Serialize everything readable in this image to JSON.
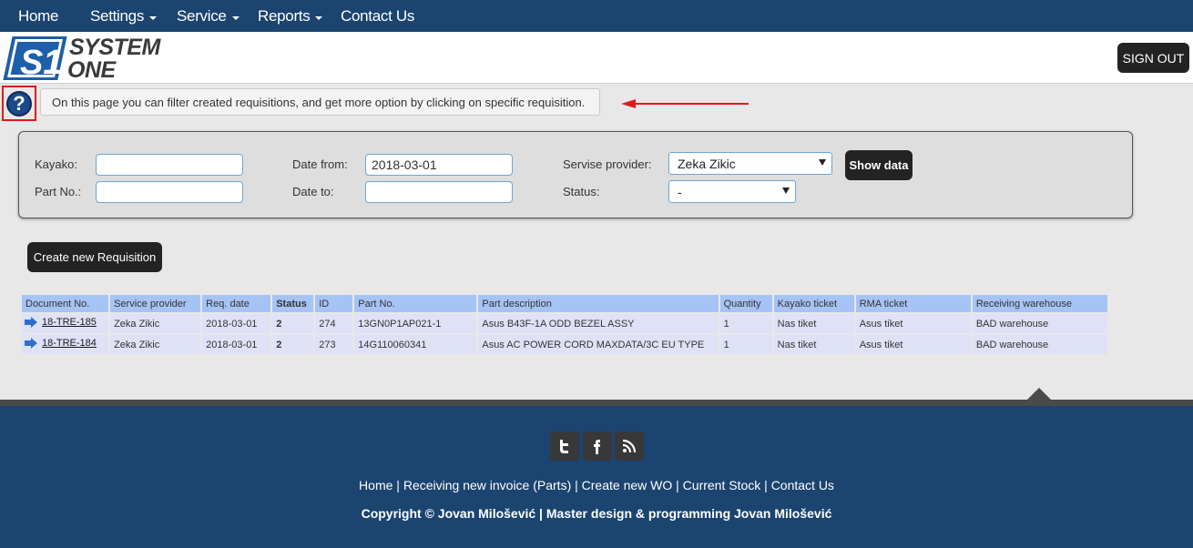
{
  "nav": {
    "items": [
      {
        "label": "Home",
        "has_caret": false
      },
      {
        "label": "Settings",
        "has_caret": true
      },
      {
        "label": "Service",
        "has_caret": true
      },
      {
        "label": "Reports",
        "has_caret": true
      },
      {
        "label": "Contact Us",
        "has_caret": false
      }
    ]
  },
  "header": {
    "logo_mark": "S1",
    "logo_line1": "SYSTEM",
    "logo_line2": "ONE",
    "signout_label": "SIGN OUT"
  },
  "help": {
    "icon_glyph": "?",
    "note": "On this page you can filter created requisitions, and get more option by clicking on specific requisition."
  },
  "filter": {
    "kayako_label": "Kayako:",
    "kayako_value": "",
    "partno_label": "Part No.:",
    "partno_value": "",
    "date_from_label": "Date from:",
    "date_from_value": "2018-03-01",
    "date_to_label": "Date to:",
    "date_to_value": "",
    "provider_label": "Servise provider:",
    "provider_value": "Zeka Zikic",
    "status_label": "Status:",
    "status_value": "-",
    "show_data_label": "Show data"
  },
  "create_button_label": "Create new Requisition",
  "table": {
    "headers": [
      "Document No.",
      "Service provider",
      "Req. date",
      "Status",
      "ID",
      "Part No.",
      "Part description",
      "Quantity",
      "Kayako ticket",
      "RMA ticket",
      "Receiving warehouse"
    ],
    "rows": [
      {
        "doc": "18-TRE-185",
        "provider": "Zeka Zikic",
        "date": "2018-03-01",
        "status": "2",
        "id": "274",
        "part_no": "13GN0P1AP021-1",
        "description": "Asus B43F-1A ODD BEZEL ASSY",
        "quantity": "1",
        "kayako": "Nas tiket",
        "rma": "Asus tiket",
        "warehouse": "BAD warehouse"
      },
      {
        "doc": "18-TRE-184",
        "provider": "Zeka Zikic",
        "date": "2018-03-01",
        "status": "2",
        "id": "273",
        "part_no": "14G110060341",
        "description": "Asus AC POWER CORD MAXDATA/3C EU TYPE",
        "quantity": "1",
        "kayako": "Nas tiket",
        "rma": "Asus tiket",
        "warehouse": "BAD warehouse"
      }
    ]
  },
  "footer": {
    "social_icons": [
      "twitter-icon",
      "facebook-icon",
      "rss-icon"
    ],
    "links": [
      "Home",
      "Receiving new invoice (Parts)",
      "Create new WO",
      "Current Stock",
      "Contact Us"
    ],
    "separator": "|",
    "copyright": "Copyright © Jovan Milošević | Master design & programming Jovan Milošević"
  },
  "colors": {
    "nav_bg": "#1b4470",
    "button_bg": "#232323",
    "table_header": "#a6c3f5",
    "table_row": "#dfe2f7",
    "highlight_red": "#e01b1b"
  }
}
